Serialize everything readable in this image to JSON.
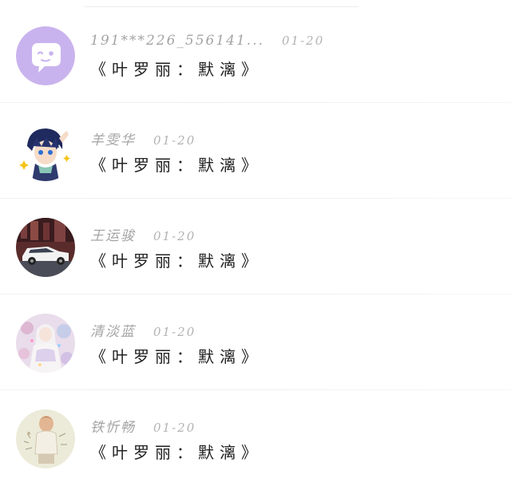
{
  "messages": [
    {
      "name": "191***226_556141...",
      "date": "01-20",
      "text": "《叶罗丽：默漓》",
      "avatar_icon": "wechat-chat-bubble-icon"
    },
    {
      "name": "羊雯华",
      "date": "01-20",
      "text": "《叶罗丽：默漓》",
      "avatar_icon": "anime-boy-avatar"
    },
    {
      "name": "王运骏",
      "date": "01-20",
      "text": "《叶罗丽：默漓》",
      "avatar_icon": "car-photo-avatar"
    },
    {
      "name": "清淡蓝",
      "date": "01-20",
      "text": "《叶罗丽：默漓》",
      "avatar_icon": "fantasy-girl-avatar"
    },
    {
      "name": "铁忻畅",
      "date": "01-20",
      "text": "《叶罗丽：默漓》",
      "avatar_icon": "sketch-person-avatar"
    }
  ],
  "colors": {
    "default_avatar_bg": "#c9b3ee",
    "name_text": "#a4a4a4",
    "message_text": "#222222",
    "divider": "#efefef"
  }
}
